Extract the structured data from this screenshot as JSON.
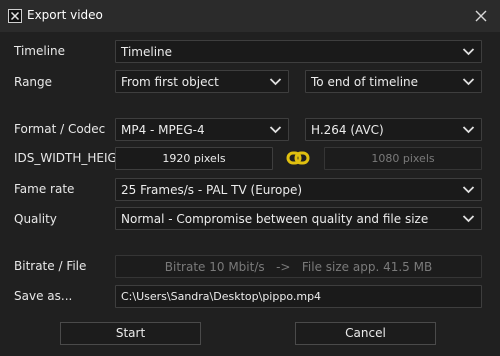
{
  "window": {
    "title": "Export video"
  },
  "rows": {
    "timeline": {
      "label": "Timeline",
      "value": "Timeline"
    },
    "range": {
      "label": "Range",
      "from": "From first object",
      "to": "To end of timeline"
    },
    "format": {
      "label": "Format / Codec",
      "container": "MP4 - MPEG-4",
      "codec": "H.264 (AVC)"
    },
    "size": {
      "label": "IDS_WIDTH_HEIGHT",
      "width": "1920 pixels",
      "height": "1080 pixels"
    },
    "framerate": {
      "label": "Fame rate",
      "value": "25 Frames/s - PAL TV (Europe)"
    },
    "quality": {
      "label": "Quality",
      "value": "Normal - Compromise between quality and file size"
    },
    "bitrate": {
      "label": "Bitrate / File",
      "value": "Bitrate 10 Mbit/s   ->   File size app. 41.5 MB"
    },
    "saveas": {
      "label": "Save as...",
      "value": "C:\\Users\\Sandra\\Desktop\\pippo.mp4"
    }
  },
  "buttons": {
    "start": "Start",
    "cancel": "Cancel"
  },
  "icons": {
    "app": "app-x-icon",
    "close": "close-icon",
    "dropdown": "chevron-down-icon",
    "link": "link-chain-icon"
  },
  "colors": {
    "link_icon": "#e0c010",
    "background": "#202020",
    "field": "#1a1a1a"
  }
}
